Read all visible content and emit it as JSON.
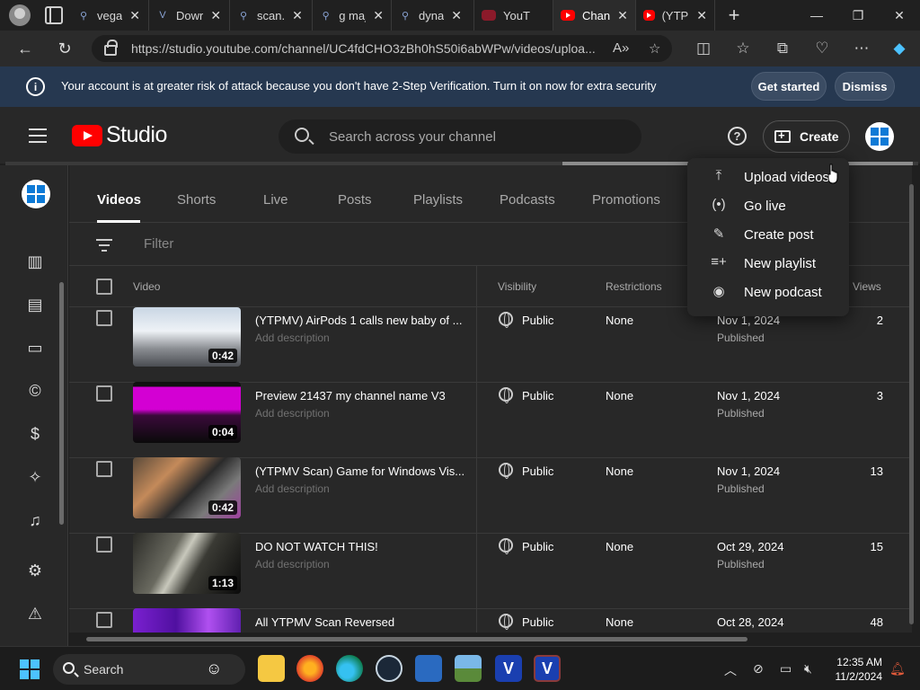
{
  "browser": {
    "tabs": [
      {
        "title": "vega",
        "icon": "search-icon",
        "active": false
      },
      {
        "title": "Dowr",
        "icon": "v-icon",
        "active": false
      },
      {
        "title": "scan.",
        "icon": "search-icon",
        "active": false
      },
      {
        "title": "g maj",
        "icon": "search-icon",
        "active": false
      },
      {
        "title": "dyna",
        "icon": "search-icon",
        "active": false
      },
      {
        "title": "YouT",
        "icon": "youtube-icon",
        "active": false
      },
      {
        "title": "Chan",
        "icon": "youtube-icon",
        "active": true
      },
      {
        "title": "(YTPN",
        "icon": "youtube-icon",
        "active": false
      }
    ],
    "url": "https://studio.youtube.com/channel/UC4fdCHO3zBh0hS50i6abWPw/videos/uploa..."
  },
  "banner": {
    "text": "Your account is at greater risk of attack because you don't have 2-Step Verification. Turn it on now for extra security",
    "get_started": "Get started",
    "dismiss": "Dismiss"
  },
  "header": {
    "logo_text": "Studio",
    "search_placeholder": "Search across your channel",
    "help": "?",
    "create": "Create"
  },
  "content_tabs": [
    "Videos",
    "Shorts",
    "Live",
    "Posts",
    "Playlists",
    "Podcasts",
    "Promotions"
  ],
  "filter_placeholder": "Filter",
  "table": {
    "headers": {
      "video": "Video",
      "visibility": "Visibility",
      "restrictions": "Restrictions",
      "views": "Views"
    },
    "rows": [
      {
        "title": "(YTPMV) AirPods 1 calls new baby of ...",
        "desc": "Add description",
        "duration": "0:42",
        "visibility": "Public",
        "restrictions": "None",
        "date": "Nov 1, 2024",
        "status": "Published",
        "views": "2"
      },
      {
        "title": "Preview 21437 my channel name V3",
        "desc": "Add description",
        "duration": "0:04",
        "visibility": "Public",
        "restrictions": "None",
        "date": "Nov 1, 2024",
        "status": "Published",
        "views": "3"
      },
      {
        "title": "(YTPMV Scan) Game for Windows Vis...",
        "desc": "Add description",
        "duration": "0:42",
        "visibility": "Public",
        "restrictions": "None",
        "date": "Nov 1, 2024",
        "status": "Published",
        "views": "13"
      },
      {
        "title": "DO NOT WATCH THIS!",
        "desc": "Add description",
        "duration": "1:13",
        "visibility": "Public",
        "restrictions": "None",
        "date": "Oct 29, 2024",
        "status": "Published",
        "views": "15"
      },
      {
        "title": "All YTPMV Scan Reversed",
        "desc": "",
        "duration": "",
        "visibility": "Public",
        "restrictions": "None",
        "date": "Oct 28, 2024",
        "status": "",
        "views": "48"
      }
    ]
  },
  "create_menu": [
    "Upload videos",
    "Go live",
    "Create post",
    "New playlist",
    "New podcast"
  ],
  "taskbar": {
    "search": "Search",
    "time": "12:35 AM",
    "date": "11/2/2024"
  },
  "colors": {
    "brand": "#ff0000",
    "banner": "#263850",
    "accent": "#0e7ad6"
  }
}
